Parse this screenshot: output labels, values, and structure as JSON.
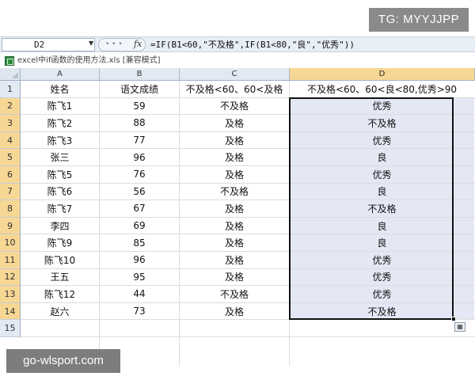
{
  "watermarks": {
    "top_right": "TG: MYYJJPP",
    "bottom_left": "go-wlsport.com"
  },
  "formula_bar": {
    "name_box": "D2",
    "fx_label": "fx",
    "formula": "=IF(B1<60,\"不及格\",IF(B1<80,\"良\",\"优秀\"))"
  },
  "workbook": {
    "title": "excel中if函数的使用方法.xls  [兼容模式]"
  },
  "columns": [
    "A",
    "B",
    "C",
    "D"
  ],
  "selected_column": "D",
  "row_numbers": [
    "1",
    "2",
    "3",
    "4",
    "5",
    "6",
    "7",
    "8",
    "9",
    "10",
    "11",
    "12",
    "13",
    "14",
    "15"
  ],
  "header_row": [
    "姓名",
    "语文成绩",
    "不及格<60、60<及格",
    "不及格<60、60<良<80,优秀>90"
  ],
  "rows": [
    [
      "陈飞1",
      "59",
      "不及格",
      "优秀"
    ],
    [
      "陈飞2",
      "88",
      "及格",
      "不及格"
    ],
    [
      "陈飞3",
      "77",
      "及格",
      "优秀"
    ],
    [
      "张三",
      "96",
      "及格",
      "良"
    ],
    [
      "陈飞5",
      "76",
      "及格",
      "优秀"
    ],
    [
      "陈飞6",
      "56",
      "不及格",
      "良"
    ],
    [
      "陈飞7",
      "67",
      "及格",
      "不及格"
    ],
    [
      "李四",
      "69",
      "及格",
      "良"
    ],
    [
      "陈飞9",
      "85",
      "及格",
      "良"
    ],
    [
      "陈飞10",
      "96",
      "及格",
      "优秀"
    ],
    [
      "王五",
      "95",
      "及格",
      "优秀"
    ],
    [
      "陈飞12",
      "44",
      "不及格",
      "优秀"
    ],
    [
      "赵六",
      "73",
      "及格",
      "不及格"
    ]
  ],
  "colors": {
    "selection_fill": "#e3e8f4",
    "header_highlight": "#f7d794",
    "header_bg": "#e2e9f2"
  }
}
